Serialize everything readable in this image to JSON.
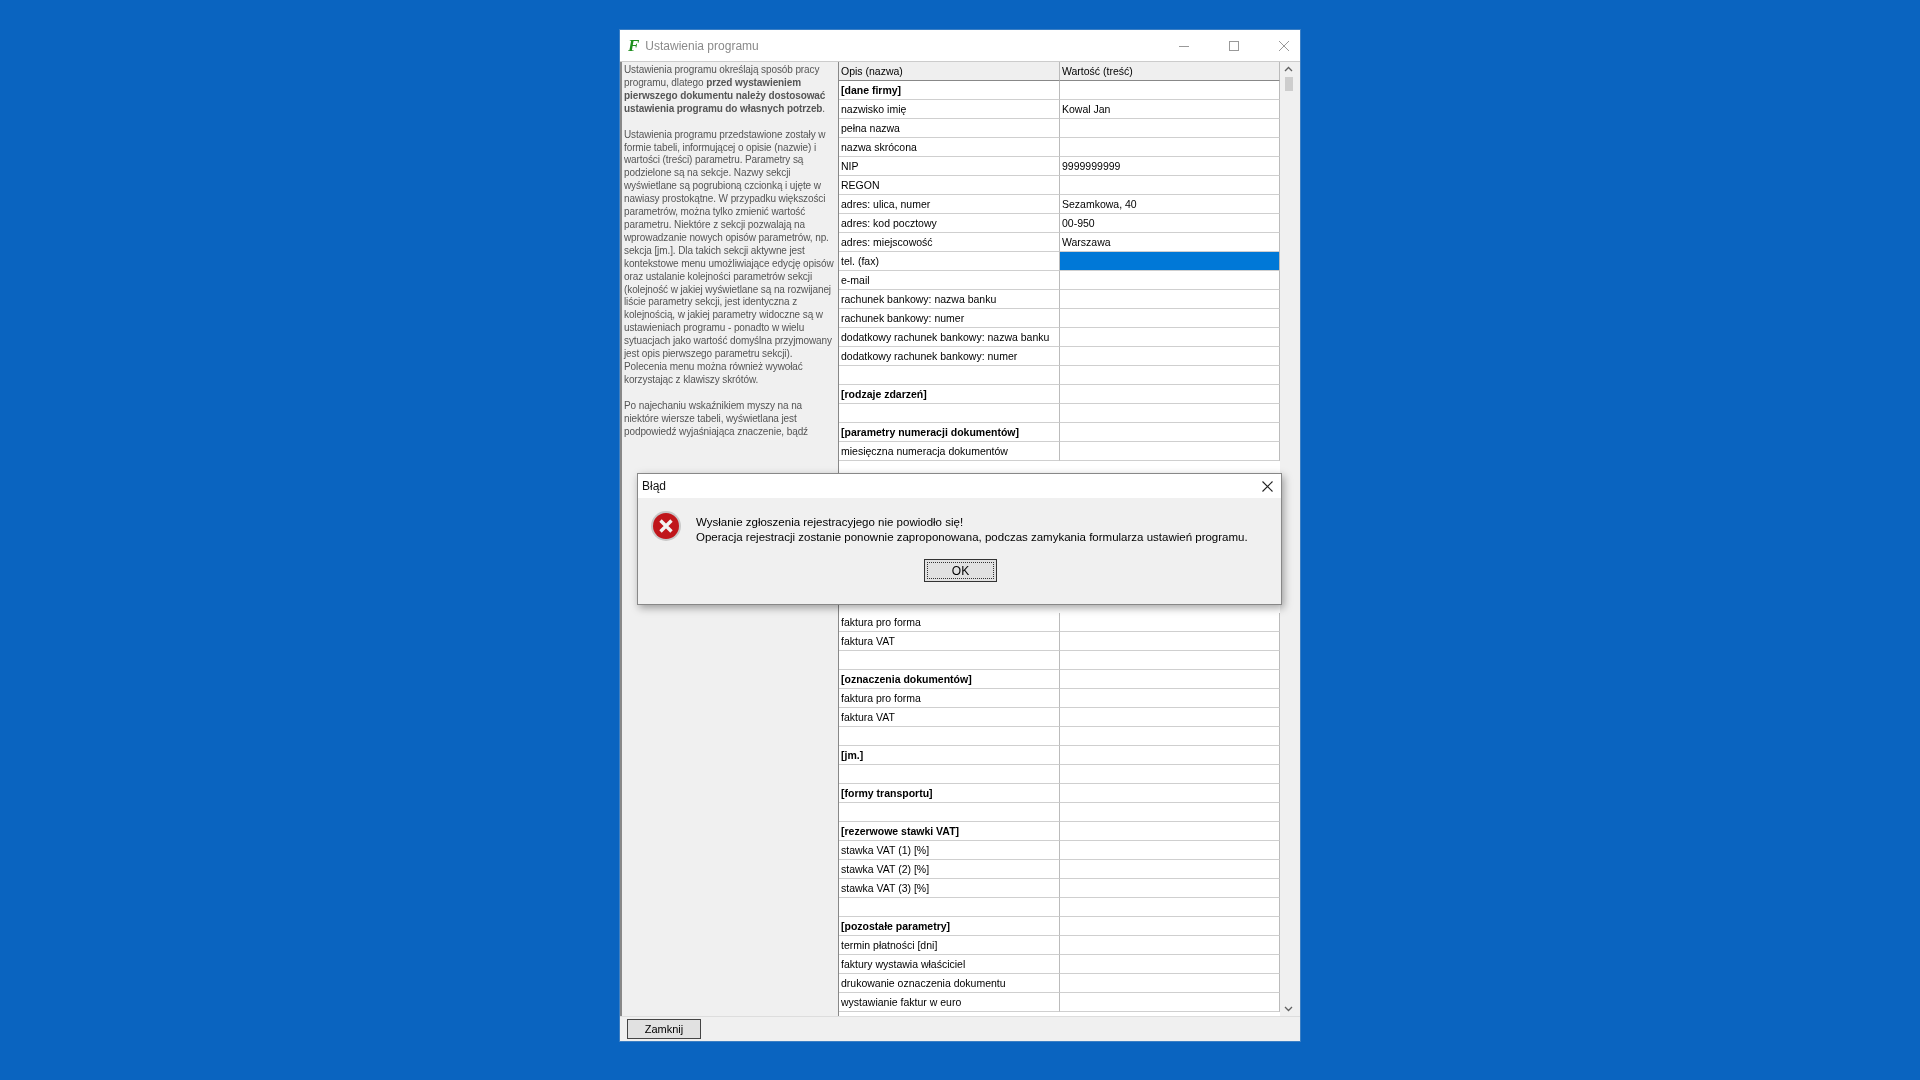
{
  "window": {
    "logo": "F",
    "title": "Ustawienia programu"
  },
  "help": {
    "paragraphs": [
      "Ustawienia programu określają sposób pracy programu, dlatego **przed wystawieniem pierwszego dokumentu należy dostosować ustawienia programu do własnych potrzeb**.",
      "Ustawienia programu przedstawione zostały w formie tabeli, informującej o opisie (nazwie) i wartości (treści) parametru. Parametry są podzielone są na sekcje. Nazwy sekcji wyświetlane są pogrubioną czcionką i ujęte w nawiasy prostokątne. W przypadku większości parametrów, można tylko zmienić wartość parametru. Niektóre z sekcji pozwalają na wprowadzanie nowych opisów parametrów, np. sekcja [jm.]. Dla takich sekcji aktywne jest kontekstowe menu umożliwiające edycję opisów oraz ustalanie kolejności parametrów sekcji (kolejność w jakiej wyświetlane są na rozwijanej liście parametry sekcji, jest identyczna z kolejnością, w jakiej parametry widoczne są w ustawieniach programu - ponadto w wielu sytuacjach jako wartość domyślna przyjmowany jest opis pierwszego parametru sekcji). Polecenia menu można również wywołać korzystając z klawiszy skrótów.",
      "Po najechaniu wskaźnikiem myszy na na niektóre wiersze tabeli, wyświetlana jest podpowiedź wyjaśniająca znaczenie, bądź"
    ]
  },
  "table": {
    "columns": [
      "Opis (nazwa)",
      "Wartość (treść)"
    ],
    "rows_top": [
      {
        "kind": "section",
        "name": "[dane firmy]",
        "selected": false
      },
      {
        "kind": "param",
        "name": "nazwisko imię",
        "value": "Kowal Jan",
        "selected": false
      },
      {
        "kind": "param",
        "name": "pełna nazwa",
        "selected": false
      },
      {
        "kind": "param",
        "name": "nazwa skrócona",
        "selected": false
      },
      {
        "kind": "param",
        "name": "NIP",
        "value": "9999999999",
        "selected": false
      },
      {
        "kind": "param",
        "name": "REGON",
        "selected": false
      },
      {
        "kind": "param",
        "name": "adres: ulica, numer",
        "value": "Sezamkowa, 40",
        "selected": false
      },
      {
        "kind": "param",
        "name": "adres: kod pocztowy",
        "value": "00-950",
        "selected": false
      },
      {
        "kind": "param",
        "name": "adres: miejscowość",
        "value": "Warszawa",
        "selected": false
      },
      {
        "kind": "param",
        "name": "tel. (fax)",
        "selected": true
      },
      {
        "kind": "param",
        "name": "e-mail",
        "selected": false
      },
      {
        "kind": "param",
        "name": "rachunek bankowy: nazwa banku",
        "selected": false
      },
      {
        "kind": "param",
        "name": "rachunek bankowy: numer",
        "selected": false
      },
      {
        "kind": "param",
        "name": "dodatkowy rachunek bankowy: nazwa banku",
        "selected": false
      },
      {
        "kind": "param",
        "name": "dodatkowy rachunek bankowy: numer",
        "selected": false
      },
      {
        "kind": "blank",
        "selected": false
      },
      {
        "kind": "section",
        "name": "[rodzaje zdarzeń]",
        "selected": false
      },
      {
        "kind": "blank",
        "selected": false
      },
      {
        "kind": "section",
        "name": "[parametry numeracji dokumentów]",
        "selected": false
      },
      {
        "kind": "param",
        "name": "miesięczna numeracja dokumentów",
        "selected": false
      }
    ],
    "rows_bottom": [
      {
        "kind": "param",
        "name": "faktura pro forma",
        "selected": false
      },
      {
        "kind": "param",
        "name": "faktura VAT",
        "selected": false
      },
      {
        "kind": "blank",
        "selected": false
      },
      {
        "kind": "section",
        "name": "[oznaczenia dokumentów]",
        "selected": false
      },
      {
        "kind": "param",
        "name": "faktura pro forma",
        "selected": false
      },
      {
        "kind": "param",
        "name": "faktura VAT",
        "selected": false
      },
      {
        "kind": "blank",
        "selected": false
      },
      {
        "kind": "section",
        "name": "[jm.]",
        "selected": false
      },
      {
        "kind": "blank",
        "selected": false
      },
      {
        "kind": "section",
        "name": "[formy transportu]",
        "selected": false
      },
      {
        "kind": "blank",
        "selected": false
      },
      {
        "kind": "section",
        "name": "[rezerwowe stawki VAT]",
        "selected": false
      },
      {
        "kind": "param",
        "name": "stawka VAT (1) [%]",
        "selected": false
      },
      {
        "kind": "param",
        "name": "stawka VAT (2) [%]",
        "selected": false
      },
      {
        "kind": "param",
        "name": "stawka VAT (3) [%]",
        "selected": false
      },
      {
        "kind": "blank",
        "selected": false
      },
      {
        "kind": "section",
        "name": "[pozostałe parametry]",
        "selected": false
      },
      {
        "kind": "param",
        "name": "termin płatności [dni]",
        "selected": false
      },
      {
        "kind": "param",
        "name": "faktury wystawia właściciel",
        "selected": false
      },
      {
        "kind": "param",
        "name": "drukowanie oznaczenia dokumentu",
        "selected": false
      },
      {
        "kind": "param",
        "name": "wystawianie faktur w euro",
        "selected": false
      }
    ]
  },
  "close_button": "Zamknij",
  "dialog": {
    "title": "Błąd",
    "lines": [
      "Wysłanie zgłoszenia rejestracyjego nie powiodło się!",
      "Operacja rejestracji zostanie ponownie zaproponowana, podczas zamykania formularza ustawień programu."
    ],
    "button": "OK"
  }
}
